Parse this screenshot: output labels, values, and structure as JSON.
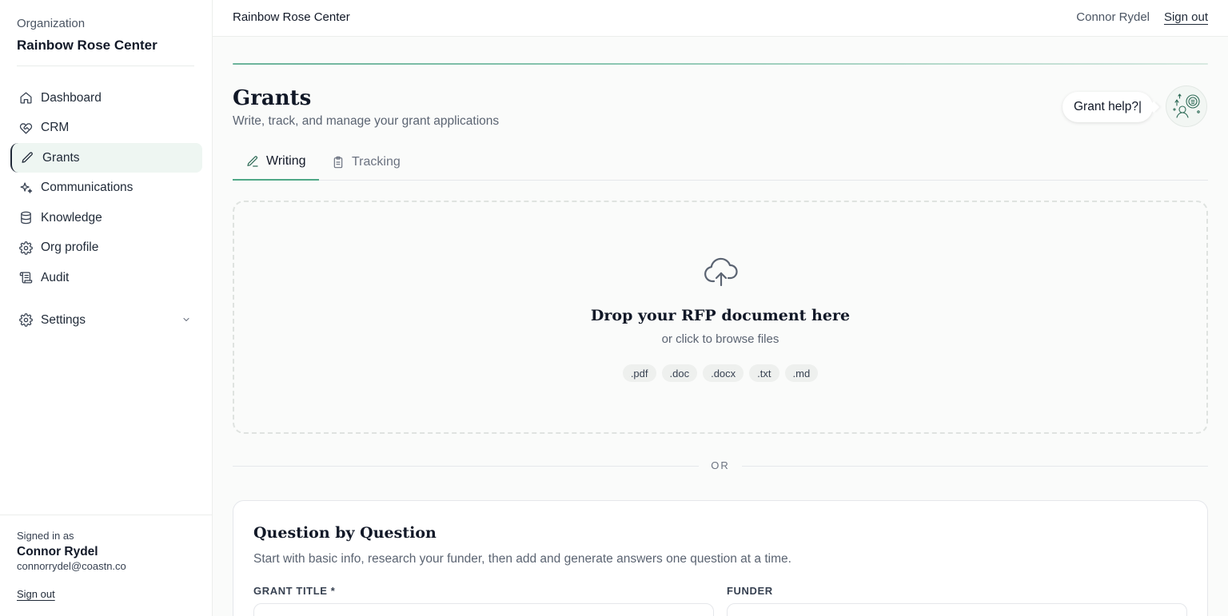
{
  "sidebar": {
    "org_label": "Organization",
    "org_name": "Rainbow Rose Center",
    "items": [
      {
        "label": "Dashboard",
        "icon": "home-icon"
      },
      {
        "label": "CRM",
        "icon": "heart-handshake-icon"
      },
      {
        "label": "Grants",
        "icon": "pencil-icon",
        "active": true
      },
      {
        "label": "Communications",
        "icon": "sparkles-icon"
      },
      {
        "label": "Knowledge",
        "icon": "database-icon"
      },
      {
        "label": "Org profile",
        "icon": "gear-icon"
      },
      {
        "label": "Audit",
        "icon": "scroll-icon"
      }
    ],
    "settings_label": "Settings",
    "signed_in_label": "Signed in as",
    "user_name": "Connor Rydel",
    "user_email": "connorrydel@coastn.co",
    "sign_out": "Sign out"
  },
  "topbar": {
    "org_name": "Rainbow Rose Center",
    "user_name": "Connor Rydel",
    "sign_out": "Sign out"
  },
  "page": {
    "title": "Grants",
    "subtitle": "Write, track, and manage your grant applications",
    "help_label": "Grant help?|"
  },
  "tabs": [
    {
      "label": "Writing",
      "icon": "pencil-icon",
      "active": true
    },
    {
      "label": "Tracking",
      "icon": "clipboard-icon",
      "active": false
    }
  ],
  "dropzone": {
    "icon": "cloud-upload-icon",
    "title": "Drop your RFP document here",
    "subtitle": "or click to browse files",
    "formats": [
      ".pdf",
      ".doc",
      ".docx",
      ".txt",
      ".md"
    ]
  },
  "divider_label": "OR",
  "question_card": {
    "title": "Question by Question",
    "subtitle": "Start with basic info, research your funder, then add and generate answers one question at a time.",
    "grant_title_label": "GRANT TITLE *",
    "funder_label": "FUNDER"
  },
  "colors": {
    "accent": "#4fa886",
    "active_bg": "#eef6f2",
    "text_primary": "#111827",
    "text_muted": "#5b6472"
  }
}
